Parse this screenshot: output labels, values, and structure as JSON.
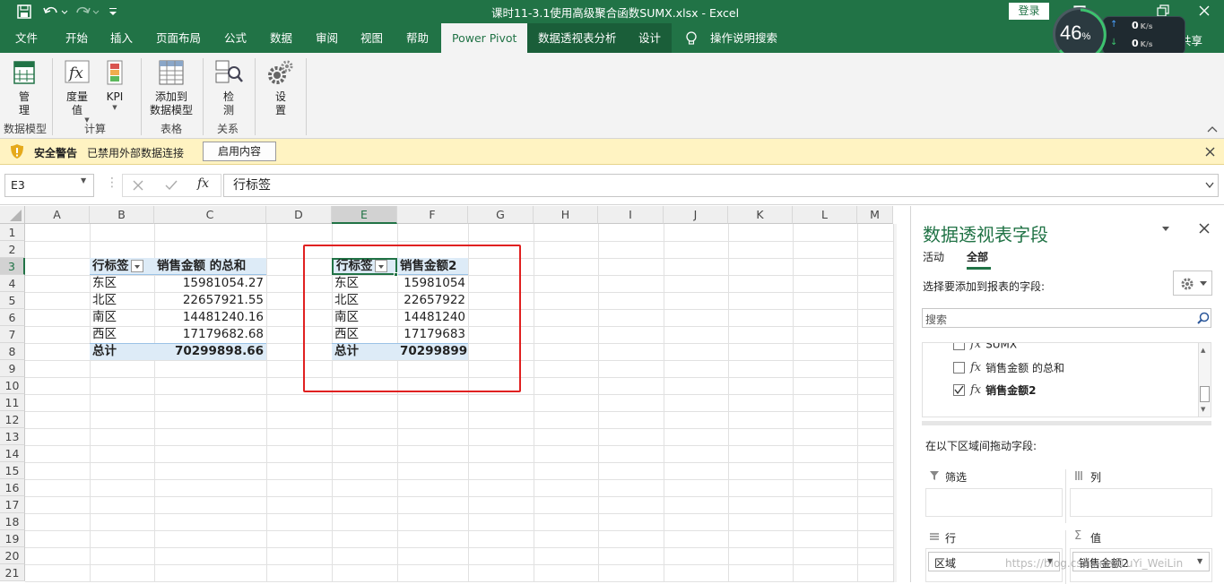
{
  "window": {
    "title": "课时11-3.1使用高级聚合函数SUMX.xlsx  -  Excel",
    "login_label": "登录",
    "share_label": "共享",
    "meter_value": "46",
    "meter_unit": "%",
    "speed_up": "0",
    "speed_up_unit": "K/s",
    "speed_down": "0",
    "speed_down_unit": "K/s"
  },
  "tabs": [
    "文件",
    "开始",
    "插入",
    "页面布局",
    "公式",
    "数据",
    "审阅",
    "视图",
    "帮助",
    "Power Pivot",
    "数据透视表分析",
    "设计",
    "操作说明搜索"
  ],
  "ribbon": {
    "manage_label": "管\n理",
    "measure_label": "度量\n值",
    "kpi_label": "KPI",
    "add_to_model_label": "添加到\n数据模型",
    "detect_label": "检\n测",
    "settings_label": "设\n置",
    "groups": [
      "数据模型",
      "计算",
      "表格",
      "关系"
    ]
  },
  "security": {
    "title": "安全警告",
    "message": "已禁用外部数据连接",
    "button": "启用内容"
  },
  "formula": {
    "name_box": "E3",
    "content": "行标签"
  },
  "sheet": {
    "columns": [
      "A",
      "B",
      "C",
      "D",
      "E",
      "F",
      "G",
      "H",
      "I",
      "J",
      "K",
      "L",
      "M"
    ],
    "rows": [
      "1",
      "2",
      "3",
      "4",
      "5",
      "6",
      "7",
      "8",
      "9",
      "10",
      "11",
      "12",
      "13",
      "14",
      "15",
      "16",
      "17",
      "18",
      "19",
      "20",
      "21"
    ],
    "pivot1": {
      "header_row": "行标签",
      "header_value": "销售金额 的总和",
      "rows": [
        {
          "label": "东区",
          "value": "15981054.27"
        },
        {
          "label": "北区",
          "value": "22657921.55"
        },
        {
          "label": "南区",
          "value": "14481240.16"
        },
        {
          "label": "西区",
          "value": "17179682.68"
        }
      ],
      "total_label": "总计",
      "total_value": "70299898.66"
    },
    "pivot2": {
      "header_row": "行标签",
      "header_value": "销售金额2",
      "rows": [
        {
          "label": "东区",
          "value": "15981054"
        },
        {
          "label": "北区",
          "value": "22657922"
        },
        {
          "label": "南区",
          "value": "14481240"
        },
        {
          "label": "西区",
          "value": "17179683"
        }
      ],
      "total_label": "总计",
      "total_value": "70299899"
    }
  },
  "panel": {
    "title": "数据透视表字段",
    "tab_active": "活动",
    "tab_all": "全部",
    "choose_label": "选择要添加到报表的字段:",
    "search_placeholder": "搜索",
    "fields": [
      {
        "name": "SUMX",
        "checked": false
      },
      {
        "name": "销售金额 的总和",
        "checked": false
      },
      {
        "name": "销售金额2",
        "checked": true
      }
    ],
    "drag_label": "在以下区域间拖动字段:",
    "filter_label": "筛选",
    "columns_label": "列",
    "rows_label": "行",
    "values_label": "值",
    "rows_item": "区域",
    "values_item": "销售金额2",
    "watermark": "https://blog.csdn.net/LuYi_WeiLin"
  },
  "colors": {
    "excel_green": "#217346",
    "pivot_header": "#ddebf7",
    "highlight_red": "#e02020"
  }
}
